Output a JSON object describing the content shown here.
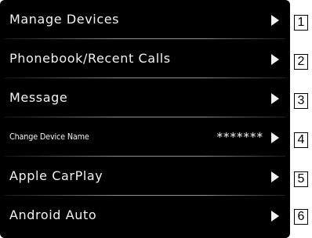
{
  "menu": {
    "items": [
      {
        "label": "Manage Devices",
        "icon": "arrow-right-icon"
      },
      {
        "label": "Phonebook/Recent Calls",
        "icon": "arrow-right-icon"
      },
      {
        "label": "Message",
        "icon": "arrow-right-icon"
      },
      {
        "label": "Change Device Name",
        "value": "*******",
        "icon": "arrow-right-icon"
      },
      {
        "label": "Apple CarPlay",
        "icon": "arrow-right-icon"
      },
      {
        "label": "Android Auto",
        "icon": "arrow-right-icon"
      }
    ]
  },
  "callouts": [
    "1",
    "2",
    "3",
    "4",
    "5",
    "6"
  ],
  "colors": {
    "background": "#000000",
    "text": "#f2f2f2",
    "divider": "#aaaaaa"
  }
}
